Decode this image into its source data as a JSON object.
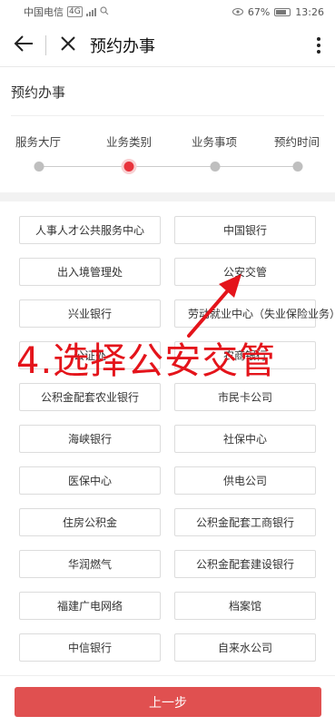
{
  "statusbar": {
    "carrier": "中国电信",
    "network": "4G",
    "battery": "67%",
    "time": "13:26"
  },
  "navbar": {
    "title": "预约办事"
  },
  "page": {
    "section_title": "预约办事"
  },
  "steps": [
    {
      "label": "服务大厅",
      "active": false
    },
    {
      "label": "业务类别",
      "active": true
    },
    {
      "label": "业务事项",
      "active": false
    },
    {
      "label": "预约时间",
      "active": false
    }
  ],
  "options": [
    "人事人才公共服务中心",
    "中国银行",
    "出入境管理处",
    "公安交管",
    "兴业银行",
    "劳动就业中心（失业保险业务）",
    "公证处",
    "农商银行",
    "公积金配套农业银行",
    "市民卡公司",
    "海峡银行",
    "社保中心",
    "医保中心",
    "供电公司",
    "住房公积金",
    "公积金配套工商银行",
    "华润燃气",
    "公积金配套建设银行",
    "福建广电网络",
    "档案馆",
    "中信银行",
    "自来水公司"
  ],
  "annotation": {
    "text": "4.选择公安交管",
    "color": "#e4141b"
  },
  "bottom": {
    "prev_label": "上一步"
  },
  "colors": {
    "accent": "#e8333c",
    "button": "#e05050"
  }
}
